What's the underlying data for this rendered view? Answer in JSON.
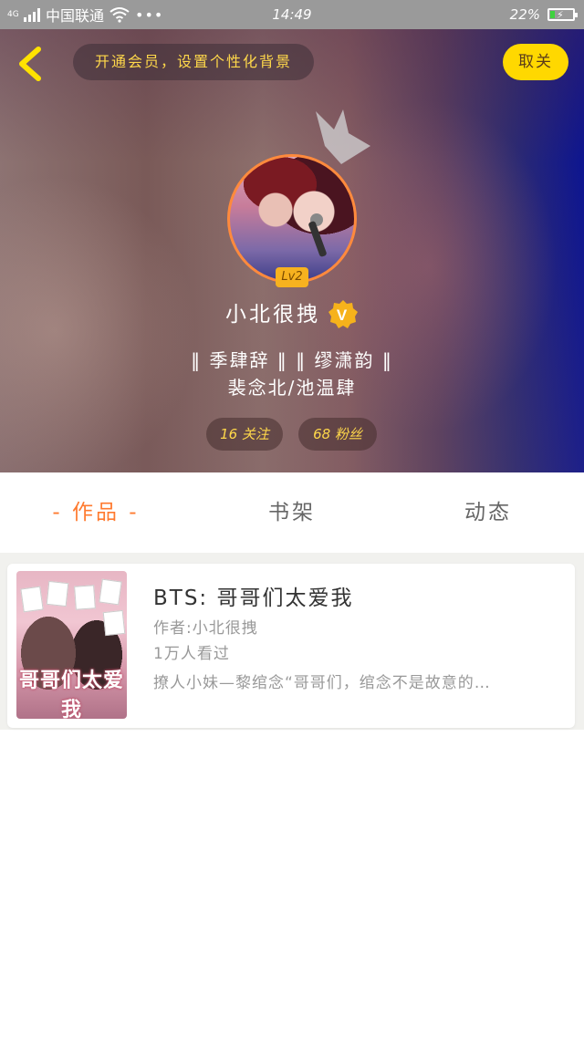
{
  "status_bar": {
    "network_type": "4G",
    "carrier": "中国联通",
    "time": "14:49",
    "battery_percent_text": "22%",
    "battery_level": 0.22,
    "battery_color": "#3ed23e"
  },
  "header": {
    "vip_banner": "开通会员，设置个性化背景",
    "follow_button": "取关"
  },
  "profile": {
    "level": "Lv2",
    "username": "小北很拽",
    "verified_badge": "V",
    "bio_line1": "‖ 季肆辞 ‖ ‖ 缪潇韵 ‖",
    "bio_line2": "裴念北/池温肆",
    "following": "16 关注",
    "fans": "68 粉丝"
  },
  "tabs": [
    {
      "label": "- 作品 -",
      "active": true
    },
    {
      "label": "书架",
      "active": false
    },
    {
      "label": "动态",
      "active": false
    }
  ],
  "works": [
    {
      "cover_text": "哥哥们太爱我",
      "title": "BTS: 哥哥们太爱我",
      "author": "作者:小北很拽",
      "views": "1万人看过",
      "description": "撩人小妹—黎绾念“哥哥们，绾念不是故意的…"
    }
  ],
  "colors": {
    "accent_yellow": "#ffd800",
    "active_tab": "#ff7a2f",
    "avatar_border": "#ff8a3d"
  }
}
